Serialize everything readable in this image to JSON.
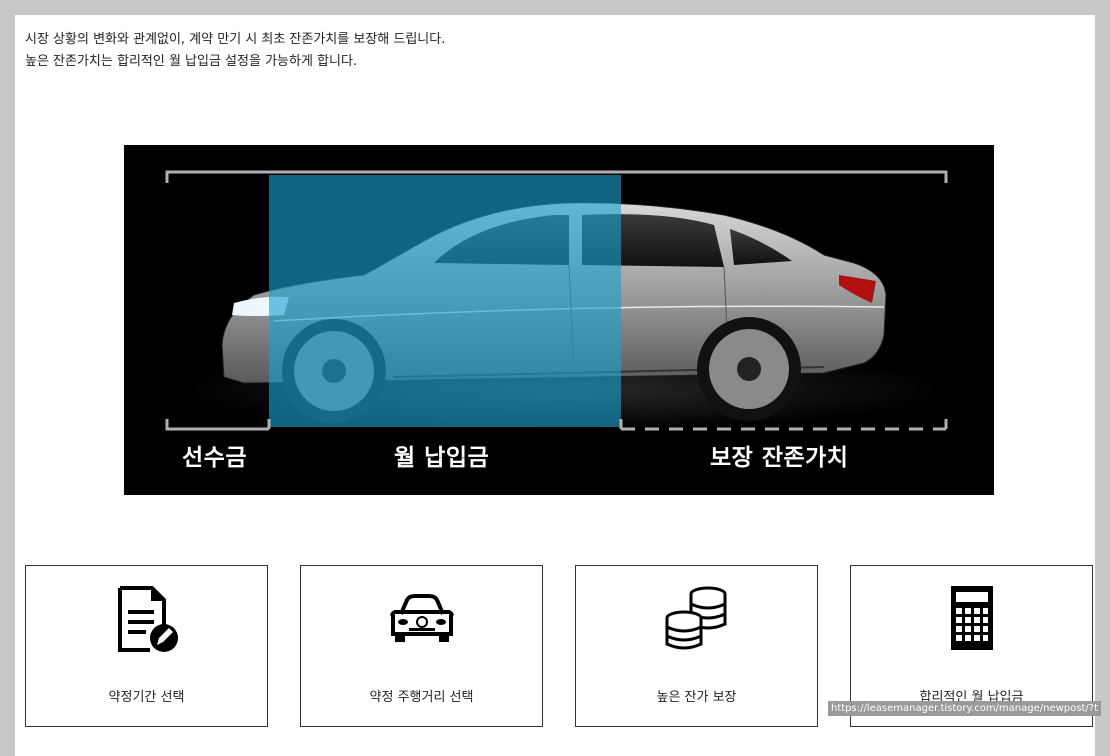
{
  "intro": {
    "line1": "시장 상황의 변화와 관계없이, 계약 만기 시 최초 잔존가치를 보장해 드립니다.",
    "line2": "높은 잔존가치는 합리적인 월 납입금 설정을 가능하게 합니다."
  },
  "hero": {
    "labels": {
      "down_payment": "선수금",
      "monthly_payment": "월 납입금",
      "guaranteed_residual": "보장 잔존가치"
    },
    "colors": {
      "highlight": "#1aa0d0",
      "background": "#000000",
      "bracket": "#b0b0b0"
    }
  },
  "cards": [
    {
      "label": "약정기간 선택",
      "icon": "document-edit-icon"
    },
    {
      "label": "약정 주행거리 선택",
      "icon": "car-icon"
    },
    {
      "label": "높은 잔가 보장",
      "icon": "coins-icon"
    },
    {
      "label": "합리적인 월 납입금",
      "icon": "calculator-icon"
    }
  ],
  "status_url": "https://leasemanager.tistory.com/manage/newpost/?t"
}
